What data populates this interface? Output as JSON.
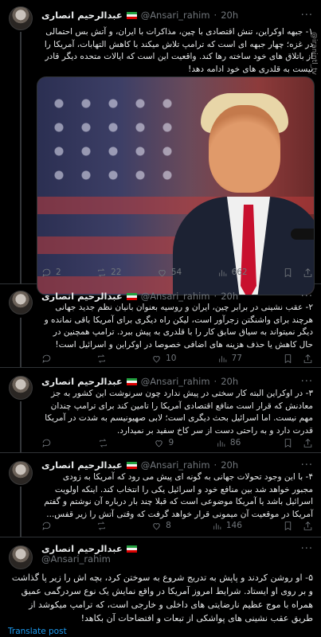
{
  "author": {
    "name": "عبدالرحیم انصاری",
    "handle": "@Ansari_rahim",
    "time": "20h"
  },
  "tweets": [
    {
      "text": "۱- جبهه اوکراین، تنش اقتصادی با چین، مذاکرات با ایران، و آتش بس احتمالی در غزه؛ چهار جبهه ای است که ترامپ تلاش میکند با کاهش التهابات، آمریکا را از باتلاق های خود ساخته رها کند. واقعیت این است که ایالات متحده دیگر قادر نیست به قلدری های خود ادامه دهد!",
      "replies": "2",
      "reposts": "22",
      "likes": "54",
      "views": "662"
    },
    {
      "text": "۲- عقب نشینی در برابر چین، ایران و روسیه بعنوان بانیان نظم جدید جهانی هرچند برای واشنگتن زجرآور است، لیکن راه دیگری برای آمریکا باقی نمانده و دیگر نمیتواند به سیاق سابق کار را با قلدری به پیش ببرد. ترامپ همچنین در حال کاهش یا حذف هزینه های اضافی خصوصا در اوکراین و اسرائیل است!",
      "replies": "",
      "reposts": "",
      "likes": "10",
      "views": "77"
    },
    {
      "text": "۳- در اوکراین البته کار سختی در پیش ندارد چون سرنوشت این کشور به جز معادنش که قرار است منافع اقتصادی آمریکا را تامین کند برای ترامپ چندان مهم نیست. اما اسرائیل بحث دیگری است؛ لابی صهیونیسم به شدت در آمریکا قدرت دارد و به راحتی دست از سر کاخ سفید بر نمیدارد.",
      "replies": "",
      "reposts": "",
      "likes": "9",
      "views": "86"
    },
    {
      "text": "۴- با این وجود تحولات جهانی به گونه ای پیش می رود که آمریکا به زودی مجبور خواهد شد بین منافع خود و اسرائیل یکی را انتخاب کند. اینکه اولویت اسرائیل باشد یا آمریکا موضوعی است که قبلا چند بار درباره آن نوشتم و گفتم آمریکا در موقعیت آن میمونی قرار خواهد گرفت که وقتی آتش را زیر قفس...",
      "replies": "",
      "reposts": "",
      "likes": "8",
      "views": "146"
    },
    {
      "text": "۵- او روشن کردند و پاپش به تدریج شروع به سوختن کرد، بچه اش را زیر پا گذاشت و بر روی او ایستاد. شرایط امروز آمریکا در واقع نمایش یک نوع سردرگمی عمیق همراه با موج عظیم نارضایتی های داخلی و خارجی است، که ترامپ میکوشد از طریق عقب نشینی های پواشکی از تبعات و افتضاحات آن بکاهد!",
      "translate": "Translate post"
    }
  ],
  "watermark": "@iranintl_tv",
  "colors": {
    "link": "#1d9bf0",
    "muted": "#71767b",
    "text": "#e7e9ea",
    "divider": "#2f3336"
  }
}
